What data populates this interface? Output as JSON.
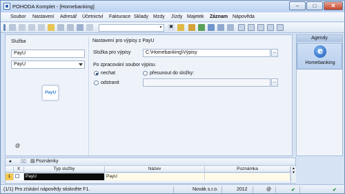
{
  "window": {
    "title": "POHODA Komplet - [Homebanking]"
  },
  "menu": [
    {
      "label": "Soubor",
      "bold": false
    },
    {
      "label": "Nastavení",
      "bold": false
    },
    {
      "label": "Adresář",
      "bold": false
    },
    {
      "label": "Účetnictví",
      "bold": false
    },
    {
      "label": "Fakturace",
      "bold": false
    },
    {
      "label": "Sklady",
      "bold": false
    },
    {
      "label": "Mzdy",
      "bold": false
    },
    {
      "label": "Jízdy",
      "bold": false
    },
    {
      "label": "Majetek",
      "bold": false
    },
    {
      "label": "Záznam",
      "bold": true
    },
    {
      "label": "Nápověda",
      "bold": false
    }
  ],
  "service": {
    "label": "Služba",
    "name_value": "PayU",
    "select_value": "PayU",
    "logo_text": "PayU",
    "help_symbol": "@"
  },
  "settings": {
    "header": "Nastavení pro výpisy z PayU",
    "folder_label": "Složka pro výpisy",
    "folder_value": "C:\\Homebanking\\Výpisy",
    "after_label": "Po zpracování soubor výpisu",
    "opt_keep": "nechat",
    "opt_move": "přesunout do složky:",
    "opt_delete": "odstranit",
    "browse": "..."
  },
  "agenda": {
    "header": "Agendy",
    "item": "Homebanking"
  },
  "bottom": {
    "tab_label": "Poznámky",
    "columns": [
      "X",
      "Typ služby",
      "Název",
      "Poznámka"
    ],
    "rows": [
      {
        "num": "1",
        "x": "",
        "type": "PayU",
        "name": "PayU",
        "note": ""
      }
    ]
  },
  "status": {
    "help_text": "(1/1) Pro získání nápovědy stiskněte F1.",
    "company": "Novák s.r.o.",
    "year": "2012",
    "at": "@"
  }
}
